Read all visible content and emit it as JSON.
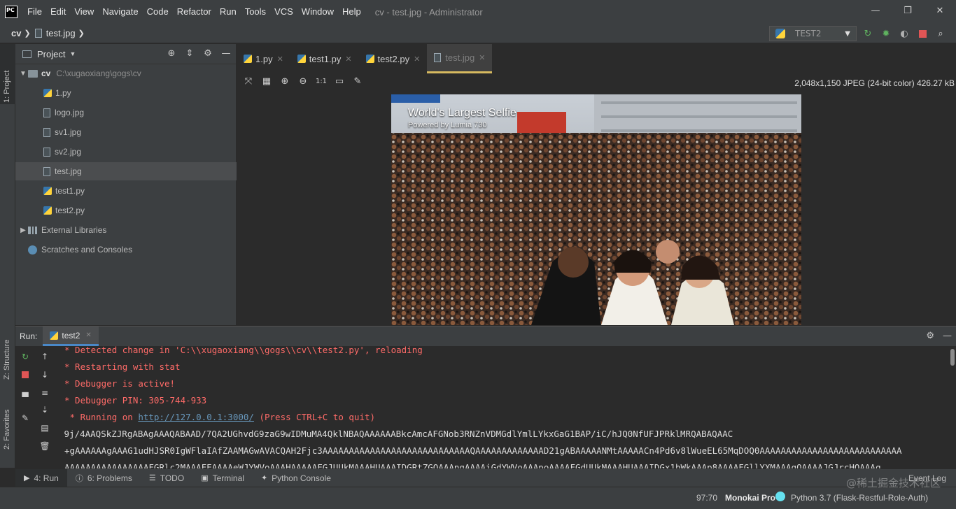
{
  "titlebar": {
    "app_icon": "PC",
    "menu": [
      "File",
      "Edit",
      "View",
      "Navigate",
      "Code",
      "Refactor",
      "Run",
      "Tools",
      "VCS",
      "Window",
      "Help"
    ],
    "window_title": "cv - test.jpg - Administrator",
    "controls": {
      "minimize": "—",
      "maximize": "❐",
      "close": "✕"
    }
  },
  "navbar": {
    "crumb_project": "cv",
    "crumb_file": "test.jpg",
    "run_config": "TEST2",
    "toolbar_icons": [
      "rerun-icon",
      "debug-icon",
      "coverage-icon",
      "stop-icon",
      "search-icon"
    ]
  },
  "leftstrip": {
    "project_label": "1: Project",
    "structure_label": "Z: Structure",
    "favorites_label": "2: Favorites"
  },
  "project": {
    "title": "Project",
    "items": [
      {
        "label": "cv",
        "path": "C:\\xugaoxiang\\gogs\\cv"
      },
      {
        "label": "1.py"
      },
      {
        "label": "logo.jpg"
      },
      {
        "label": "sv1.jpg"
      },
      {
        "label": "sv2.jpg"
      },
      {
        "label": "test.jpg"
      },
      {
        "label": "test1.py"
      },
      {
        "label": "test2.py"
      },
      {
        "label": "External Libraries"
      },
      {
        "label": "Scratches and Consoles"
      }
    ]
  },
  "editor": {
    "tabs": [
      {
        "label": "1.py"
      },
      {
        "label": "test1.py"
      },
      {
        "label": "test2.py"
      },
      {
        "label": "test.jpg"
      }
    ],
    "image_info": "2,048x1,150 JPEG (24-bit color) 426.27 kB",
    "zoom_label": "1:1",
    "photo_title": "World's Largest Selfie",
    "photo_subtitle": "Powered by Lumia 730"
  },
  "run": {
    "label": "Run:",
    "tab": "test2",
    "lines": [
      {
        "text": " * Detected change in 'C:\\\\xugaoxiang\\\\gogs\\\\cv\\\\test2.py', reloading"
      },
      {
        "text": " * Restarting with stat"
      },
      {
        "text": " * Debugger is active!"
      },
      {
        "text": " * Debugger PIN: 305-744-933"
      },
      {
        "text_before": " * Running on ",
        "link": "http://127.0.0.1:3000/",
        "text_after": " (Press CTRL+C to quit)"
      },
      {
        "text": "/9j/4AAQSkZJRgABAgAAAQABAAD/7QA2UGhvdG9zaG9wIDMuMA4QklNBAQAAAAAABkcAmcAFGNob3RNZnVDMGdlYmlLYkxGaG1BAP/iC/hJQ0NfUFJPRklMRQABAQAAC"
      },
      {
        "text": "+gAAAAAAgAAAG1udHJSR0IgWFlaIAfZAAMAGwAVACQAH2Fjc3AAAAAAAAAAAAAAAAAAAAAAAAAAAAQAAAAAAAAAAAAAD21gABAAAAANMtAAAAACn4Pd6v8lWueEL65MqDOQ0AAAAAAAAAAAAAAAAAAAAAAAAAAA"
      },
      {
        "text": "AAAAAAAAAAAAAAAAFGRlc2MAAAFEAAAAeWJYWVoAAAHAAAAAFGJUUkMAAAHUAAAIDGRtZGQAAAngAAAAiGdYWVoAAApoAAAAFGdUUkMAAAHUAAAIDGx1bWkAAAp8AAAAFGllYXMAAAqQAAAAJGJrcHQAAAq"
      }
    ]
  },
  "bottom_tools": [
    {
      "label": "4: Run"
    },
    {
      "label": "6: Problems"
    },
    {
      "label": "TODO"
    },
    {
      "label": "Terminal"
    },
    {
      "label": "Python Console"
    }
  ],
  "event_log": "Event Log",
  "status": {
    "position": "97:70",
    "theme": "Monokai Pro",
    "interpreter": "Python 3.7 (Flask-Restful-Role-Auth)"
  },
  "watermark": "@稀土掘金技术社区",
  "colors": {
    "accent_tab": "#d6b95f",
    "run_tab": "#4a88c7",
    "error_text": "#ff6b68",
    "link": "#6897bb",
    "theme_dot": "#65e1f0"
  }
}
